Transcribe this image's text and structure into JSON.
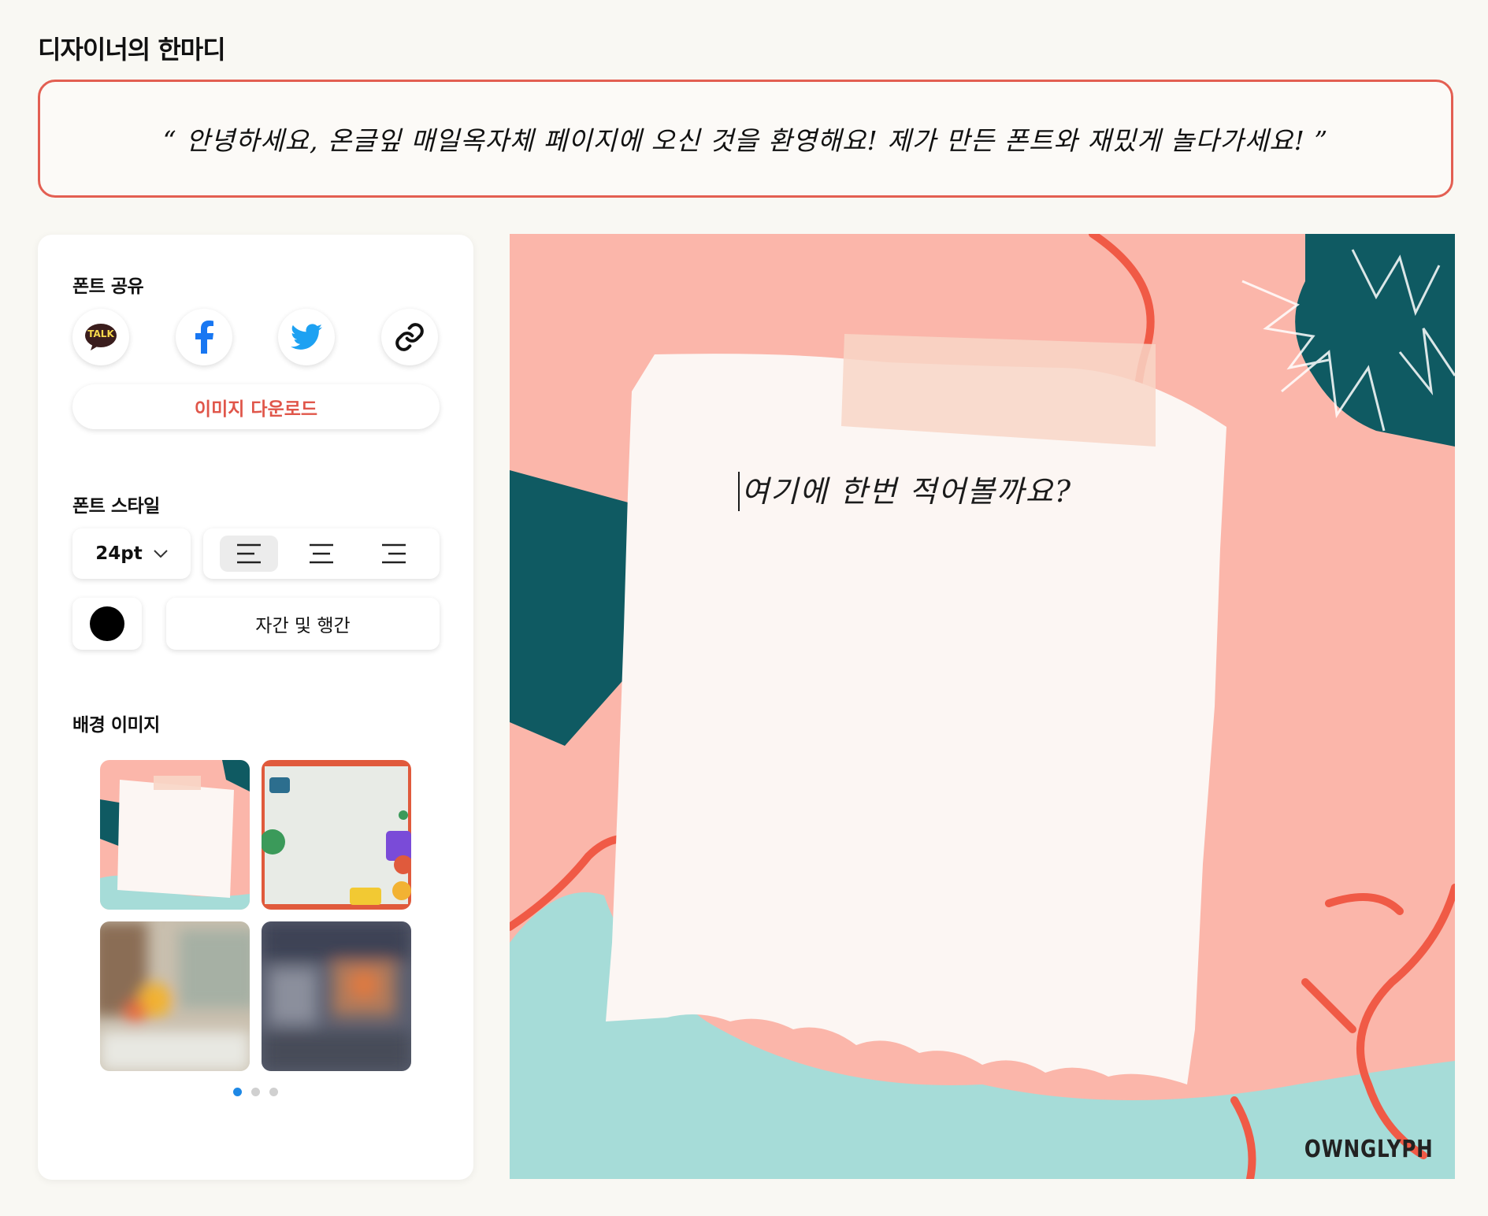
{
  "section_title": "디자이너의 한마디",
  "quote": "“ 안녕하세요, 온글잎 매일옥자체 페이지에 오신 것을 환영해요! 제가 만든 폰트와 재밌게 놀다가세요! ”",
  "share": {
    "label": "폰트 공유",
    "kakao_text": "TALK",
    "buttons": [
      "kakaotalk-icon",
      "facebook-icon",
      "twitter-icon",
      "link-icon"
    ],
    "download_label": "이미지 다운로드"
  },
  "style": {
    "label": "폰트 스타일",
    "font_size": "24pt",
    "align_options": [
      "align-left",
      "align-center",
      "align-right"
    ],
    "align_selected": "align-left",
    "text_color": "#000000",
    "spacing_label": "자간 및 행간"
  },
  "backgrounds": {
    "label": "배경 이미지",
    "thumbnails": [
      "torn-paper-note",
      "stickers-paper",
      "blurred-street-light",
      "blurred-dark-street"
    ],
    "selected_index": 0,
    "pages": 3,
    "current_page": 1
  },
  "canvas": {
    "text": "여기에 한번 적어볼까요?",
    "brand": "OWNGLYPH"
  },
  "colors": {
    "accent": "#e35f52",
    "page_bg": "#f9f8f3",
    "pink": "#fbb6aa",
    "teal_dark": "#0f5a62",
    "mint": "#a6dcd8",
    "red_line": "#f05a46",
    "paper": "#fcf6f3",
    "dot_active": "#1e88e5"
  }
}
